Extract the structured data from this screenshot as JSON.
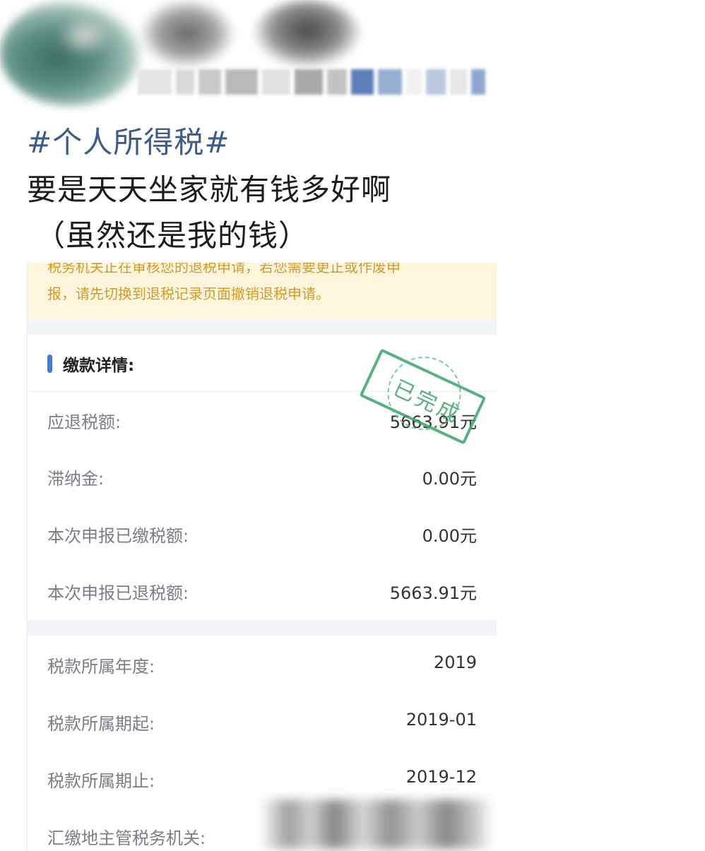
{
  "post": {
    "hashtag": "#个人所得税#",
    "text_line_1": "要是天天坐家就有钱多好啊",
    "text_line_2": "（虽然还是我的钱）"
  },
  "notice": {
    "line_1": "税务机关正在审核您的退税申请，若您需要更正或作废申",
    "line_2": "报，请先切换到退税记录页面撤销退税申请。"
  },
  "section": {
    "title": "缴款详情:"
  },
  "stamp": {
    "text": "已完成",
    "color": "#3aa56a"
  },
  "payment_rows": [
    {
      "label": "应退税额:",
      "value": "5663.91元"
    },
    {
      "label": "滞纳金:",
      "value": "0.00元"
    },
    {
      "label": "本次申报已缴税额:",
      "value": "0.00元"
    },
    {
      "label": "本次申报已退税额:",
      "value": "5663.91元"
    }
  ],
  "period_rows": [
    {
      "label": "税款所属年度:",
      "value": "2019"
    },
    {
      "label": "税款所属期起:",
      "value": "2019-01"
    },
    {
      "label": "税款所属期止:",
      "value": "2019-12"
    },
    {
      "label": "汇缴地主管税务机关:",
      "value": ""
    }
  ],
  "colors": {
    "hashtag": "#3d5d88",
    "accent_bar": "#3b7ddd",
    "notice_bg": "#fdf6dd",
    "notice_text": "#d29a2c"
  }
}
